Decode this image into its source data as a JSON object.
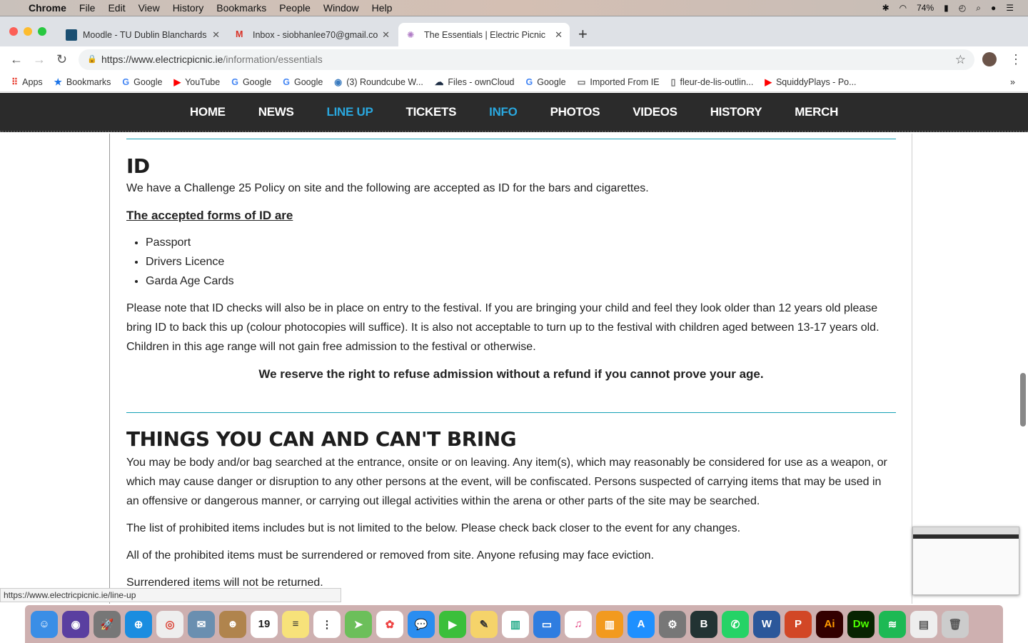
{
  "menubar": {
    "app": "Chrome",
    "items": [
      "File",
      "Edit",
      "View",
      "History",
      "Bookmarks",
      "People",
      "Window",
      "Help"
    ],
    "battery": "74%"
  },
  "tabs": [
    {
      "title": "Moodle - TU Dublin Blanchards",
      "color": "#1b4f72"
    },
    {
      "title": "Inbox - siobhanlee70@gmail.co",
      "color": "#d93025"
    },
    {
      "title": "The Essentials | Electric Picnic",
      "color": "#b07cc6"
    }
  ],
  "address": {
    "host": "https://www.electricpicnic.ie",
    "path": "/information/essentials"
  },
  "bookmarks": [
    "Apps",
    "Bookmarks",
    "Google",
    "YouTube",
    "Google",
    "Google",
    "(3) Roundcube W...",
    "Files - ownCloud",
    "Google",
    "Imported From IE",
    "fleur-de-lis-outlin...",
    "SquiddyPlays - Po..."
  ],
  "nav": [
    "HOME",
    "NEWS",
    "LINE UP",
    "TICKETS",
    "INFO",
    "PHOTOS",
    "VIDEOS",
    "HISTORY",
    "MERCH"
  ],
  "id_section": {
    "title": "ID",
    "intro": "We have a Challenge 25 Policy on site and the following are accepted as ID for the bars and cigarettes.",
    "subheading": "The accepted forms of ID are",
    "items": [
      "Passport",
      "Drivers Licence",
      "Garda Age Cards"
    ],
    "note": "Please note that ID checks will also be in place on entry to the festival. If you are bringing your child and feel they look older than 12 years old please bring ID to back this up (colour photocopies will suffice). It is also not acceptable to turn up to the festival with children aged between 13-17 years old. Children in this age range will not gain free admission to the festival or otherwise.",
    "warning": "We reserve the right to refuse admission without a refund if you cannot prove your age."
  },
  "bring_section": {
    "title": "THINGS YOU CAN AND CAN'T BRING",
    "paragraphs": [
      "You may be body and/or bag searched at the entrance, onsite or on leaving. Any item(s), which may reasonably be considered for use as a weapon, or which may cause danger or disruption to any other persons at the event, will be confiscated. Persons suspected of carrying items that may be used in an offensive or dangerous manner, or carrying out illegal activities within the arena or other parts of the site may be searched.",
      "The list of prohibited items includes but is not limited to the below. Please check back closer to the event for any changes.",
      "All of the prohibited items must be surrendered or removed from site. Anyone refusing may face eviction.",
      "Surrendered items will not be returned."
    ]
  },
  "status_url": "https://www.electricpicnic.ie/line-up",
  "dock_date": "19"
}
